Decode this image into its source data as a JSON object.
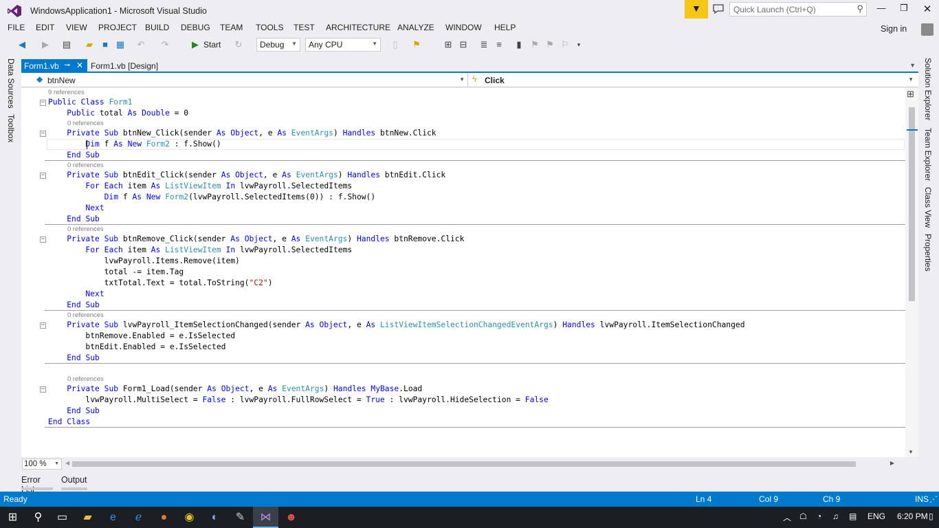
{
  "window": {
    "title": "WindowsApplication1 - Microsoft Visual Studio",
    "quick_launch_placeholder": "Quick Launch (Ctrl+Q)",
    "sign_in": "Sign in"
  },
  "menu": [
    "FILE",
    "EDIT",
    "VIEW",
    "PROJECT",
    "BUILD",
    "DEBUG",
    "TEAM",
    "TOOLS",
    "TEST",
    "ARCHITECTURE",
    "ANALYZE",
    "WINDOW",
    "HELP"
  ],
  "toolbar": {
    "start_label": "Start",
    "configuration": "Debug",
    "platform": "Any CPU"
  },
  "left_panels": [
    "Data Sources",
    "Toolbox"
  ],
  "right_panels": [
    "Solution Explorer",
    "Team Explorer",
    "Class View",
    "Properties"
  ],
  "tabs": [
    {
      "label": "Form1.vb",
      "active": true
    },
    {
      "label": "Form1.vb [Design]",
      "active": false
    }
  ],
  "navbar": {
    "object": "btnNew",
    "member": "Click"
  },
  "code": {
    "references": [
      "9 references",
      "0 references",
      "0 references",
      "0 references",
      "0 references",
      "0 references"
    ],
    "lines": [
      "Public Class Form1",
      "    Public total As Double = 0",
      "    Private Sub btnNew_Click(sender As Object, e As EventArgs) Handles btnNew.Click",
      "        Dim f As New Form2 : f.Show()",
      "    End Sub",
      "    Private Sub btnEdit_Click(sender As Object, e As EventArgs) Handles btnEdit.Click",
      "        For Each item As ListViewItem In lvwPayroll.SelectedItems",
      "            Dim f As New Form2(lvwPayroll.SelectedItems(0)) : f.Show()",
      "        Next",
      "    End Sub",
      "    Private Sub btnRemove_Click(sender As Object, e As EventArgs) Handles btnRemove.Click",
      "        For Each item As ListViewItem In lvwPayroll.SelectedItems",
      "            lvwPayroll.Items.Remove(item)",
      "            total -= item.Tag",
      "            txtTotal.Text = total.ToString(\"C2\")",
      "        Next",
      "    End Sub",
      "    Private Sub lvwPayroll_ItemSelectionChanged(sender As Object, e As ListViewItemSelectionChangedEventArgs) Handles lvwPayroll.ItemSelectionChanged",
      "        btnRemove.Enabled = e.IsSelected",
      "        btnEdit.Enabled = e.IsSelected",
      "    End Sub",
      "    Private Sub Form1_Load(sender As Object, e As EventArgs) Handles MyBase.Load",
      "        lvwPayroll.MultiSelect = False : lvwPayroll.FullRowSelect = True : lvwPayroll.HideSelection = False",
      "    End Sub",
      "End Class"
    ]
  },
  "zoom": "100 %",
  "bottom_tabs": [
    "Error List",
    "Output"
  ],
  "status": {
    "state": "Ready",
    "ln": "Ln 4",
    "col": "Col 9",
    "ch": "Ch 9",
    "mode": "INS"
  },
  "tray": {
    "language": "ENG",
    "time": "6:20 PM"
  },
  "colors": {
    "accent": "#007acc",
    "keyword": "#0000ff",
    "type": "#2b91af",
    "string": "#a31515",
    "notification": "#f5c518"
  }
}
